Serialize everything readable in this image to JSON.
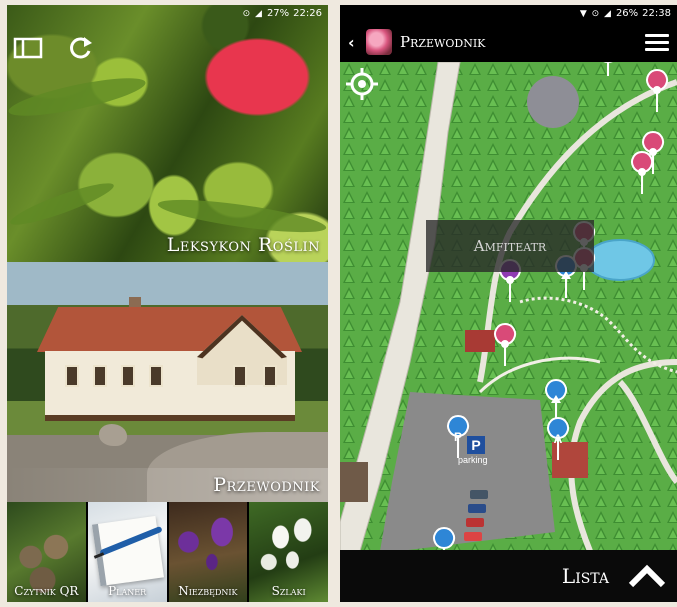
{
  "left_phone": {
    "status": {
      "icons": "⊙ ◢",
      "battery": "27%",
      "time": "22:26"
    },
    "top_icons": [
      "tablet-icon",
      "refresh-icon"
    ],
    "tiles": {
      "lexicon": {
        "label": "Leksykon Roślin"
      },
      "guide": {
        "label": "Przewodnik"
      }
    },
    "bottom_tiles": [
      {
        "label": "Czytnik QR"
      },
      {
        "label": "Planer"
      },
      {
        "label": "Niezbędnik"
      },
      {
        "label": "Szlaki"
      }
    ]
  },
  "right_phone": {
    "status": {
      "icons": "▼ ⊙ ◢",
      "battery": "26%",
      "time": "22:38"
    },
    "appbar": {
      "back": "‹",
      "title": "Przewodnik"
    },
    "map": {
      "tooltip": "Amfiteatr",
      "parking_letter": "P",
      "parking_text": "parking"
    },
    "bottombar": {
      "list_label": "Lista"
    },
    "colors": {
      "map_green": "#5db24a",
      "road": "#e9e6dd",
      "pin_pink": "#d94a78",
      "pin_purple": "#8f3bb3",
      "pin_blue": "#2e86d6"
    }
  }
}
